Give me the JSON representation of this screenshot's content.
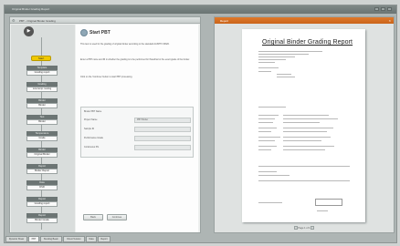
{
  "window": {
    "title": "Original Binder Grading Report"
  },
  "left_pane": {
    "title": "PBT - Original Binder Grading",
    "start_label": "Start",
    "steps": [
      {
        "header": "Template",
        "value": "Grading report"
      },
      {
        "header": "Grading",
        "value": "Low temp. testing"
      },
      {
        "header": "Binder",
        "value": "Binder"
      },
      {
        "header": "Test",
        "value": "Binder"
      },
      {
        "header": "Temperature",
        "value": "Grade"
      },
      {
        "header": "Binder",
        "value": "Original Binder"
      },
      {
        "header": "Report",
        "value": "Binder Report"
      },
      {
        "header": "Data",
        "value": "DSR"
      },
      {
        "header": "Report",
        "value": "Grading report"
      },
      {
        "header": "Report",
        "value": "Binder Grade"
      }
    ]
  },
  "wizard": {
    "title": "Start PBT",
    "paragraphs": [
      "This item is used for the grading of original binder according to the standard AASHTO M320.",
      "Enter a PBT name and fill in whether the grading is to be performed for Pass/Fail or the exact grade of the binder.",
      "Click on the 'Continue' button to start PBT processing."
    ],
    "panel_title": "Binder PBT Name",
    "fields": [
      {
        "label": "Project Name",
        "value": "PBT Binder"
      },
      {
        "label": "Sample ID",
        "value": ""
      },
      {
        "label": "Performance Grade",
        "value": ""
      },
      {
        "label": "Continuous PG",
        "value": ""
      }
    ],
    "buttons": {
      "back": "Back",
      "continue": "Continue"
    }
  },
  "report": {
    "tab_title": "Report",
    "title": "Original Binder Grading Report",
    "page_indicator": "Page 1 of 1"
  },
  "bottom_tabs": [
    "Dynamic Shear",
    "PBT",
    "Bending Beam",
    "Direct Tension",
    "Data",
    "Report"
  ],
  "colors": {
    "accent_orange": "#d36e22",
    "start_yellow": "#f0c800",
    "step_header": "#6c7574"
  }
}
